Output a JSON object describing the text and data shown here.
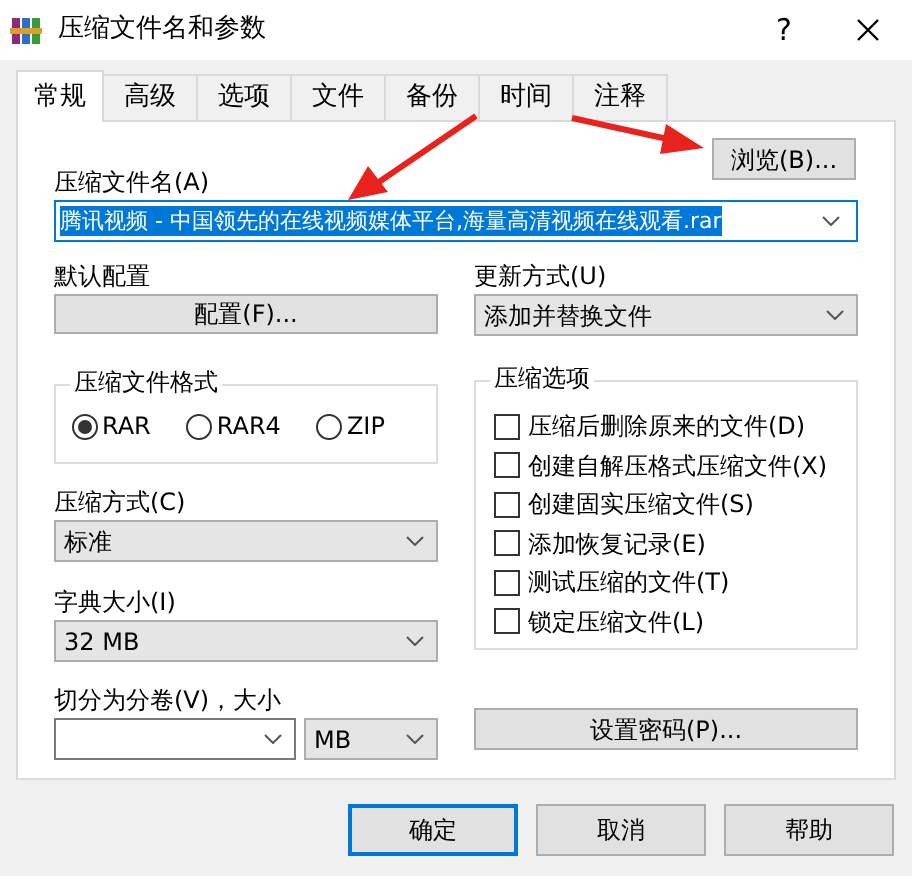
{
  "window": {
    "title": "压缩文件名和参数",
    "help": "?"
  },
  "tabs": [
    {
      "label": "常规",
      "selected": true
    },
    {
      "label": "高级",
      "selected": false
    },
    {
      "label": "选项",
      "selected": false
    },
    {
      "label": "文件",
      "selected": false
    },
    {
      "label": "备份",
      "selected": false
    },
    {
      "label": "时间",
      "selected": false
    },
    {
      "label": "注释",
      "selected": false
    }
  ],
  "archive_name": {
    "label": "压缩文件名(A)",
    "value": "腾讯视频 - 中国领先的在线视频媒体平台,海量高清视频在线观看.rar",
    "selected": true
  },
  "browse_button": "浏览(B)...",
  "default_profile": {
    "label": "默认配置",
    "button": "配置(F)..."
  },
  "update_mode": {
    "label": "更新方式(U)",
    "value": "添加并替换文件"
  },
  "archive_format": {
    "title": "压缩文件格式",
    "options": [
      {
        "label": "RAR",
        "selected": true
      },
      {
        "label": "RAR4",
        "selected": false
      },
      {
        "label": "ZIP",
        "selected": false
      }
    ]
  },
  "compression_method": {
    "label": "压缩方式(C)",
    "value": "标准"
  },
  "dictionary_size": {
    "label": "字典大小(I)",
    "value": "32 MB"
  },
  "split_volumes": {
    "label": "切分为分卷(V)，大小",
    "unit": "MB"
  },
  "archive_options": {
    "title": "压缩选项",
    "items": [
      {
        "label": "压缩后删除原来的文件(D)",
        "checked": false
      },
      {
        "label": "创建自解压格式压缩文件(X)",
        "checked": false
      },
      {
        "label": "创建固实压缩文件(S)",
        "checked": false
      },
      {
        "label": "添加恢复记录(E)",
        "checked": false
      },
      {
        "label": "测试压缩的文件(T)",
        "checked": false
      },
      {
        "label": "锁定压缩文件(L)",
        "checked": false
      }
    ]
  },
  "password_button": "设置密码(P)...",
  "buttons": [
    {
      "label": "确定",
      "default": true
    },
    {
      "label": "取消",
      "default": false
    },
    {
      "label": "帮助",
      "default": false
    }
  ]
}
